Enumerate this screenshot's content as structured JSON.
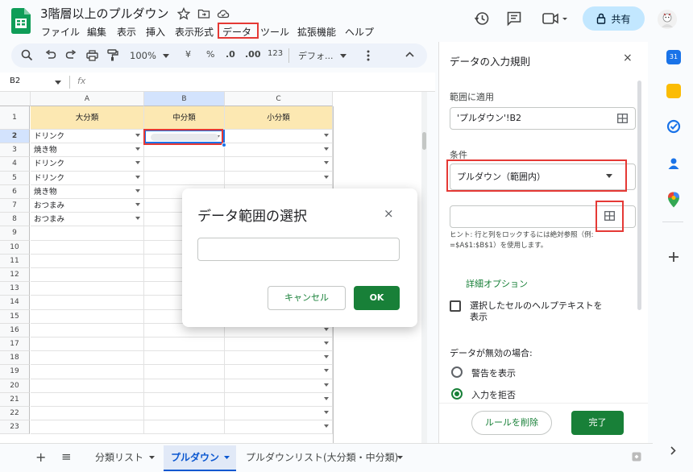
{
  "app": {
    "title": "3階層以上のプルダウン",
    "share_label": "共有"
  },
  "menu": {
    "items": [
      "ファイル",
      "編集",
      "表示",
      "挿入",
      "表示形式",
      "データ",
      "ツール",
      "拡張機能",
      "ヘルプ"
    ],
    "highlighted": "データ"
  },
  "toolbar": {
    "zoom": "100%",
    "currency": "¥",
    "percent": "%",
    "dec_less": ".0",
    "dec_more": ".00",
    "number_fmt": "123",
    "font": "デフォ..."
  },
  "formula": {
    "cell_ref": "B2",
    "fx": "fx"
  },
  "grid": {
    "columns": [
      "A",
      "B",
      "C"
    ],
    "header_row": [
      "大分類",
      "中分類",
      "小分類"
    ],
    "rows": [
      "1",
      "2",
      "3",
      "4",
      "5",
      "6",
      "7",
      "8",
      "9",
      "10",
      "11",
      "12",
      "13",
      "14",
      "15",
      "16",
      "17",
      "18",
      "19",
      "20",
      "21",
      "22",
      "23"
    ],
    "col_a_values": [
      "ドリンク",
      "焼き物",
      "ドリンク",
      "ドリンク",
      "焼き物",
      "おつまみ",
      "おつまみ"
    ]
  },
  "dialog": {
    "title": "データ範囲の選択",
    "close": "×",
    "input_value": "",
    "cancel_label": "キャンセル",
    "ok_label": "OK"
  },
  "panel": {
    "title": "データの入力規則",
    "close": "×",
    "apply_label": "範囲に適用",
    "apply_value": "'プルダウン'!B2",
    "condition_label": "条件",
    "condition_value": "プルダウン（範囲内）",
    "range_value": "",
    "hint": "ヒント: 行と列をロックするには絶対参照（例: =$A$1:$B$1）を使用します。",
    "advanced_options": "詳細オプション",
    "help_text_checkbox": "選択したセルのヘルプテキストを表示",
    "invalid_label": "データが無効の場合:",
    "option_warn": "警告を表示",
    "option_reject": "入力を拒否",
    "selected_option": "入力を拒否",
    "delete_label": "ルールを削除",
    "done_label": "完了"
  },
  "tabs": {
    "items": [
      "分類リスト",
      "プルダウン",
      "プルダウンリスト(大分類・中分類)"
    ],
    "active": "プルダウン",
    "add": "+",
    "all": "≡"
  },
  "colors": {
    "green": "#188038",
    "header_fill": "#fce8b2",
    "highlight_red": "#e53935",
    "share_fill": "#c2e7ff"
  }
}
